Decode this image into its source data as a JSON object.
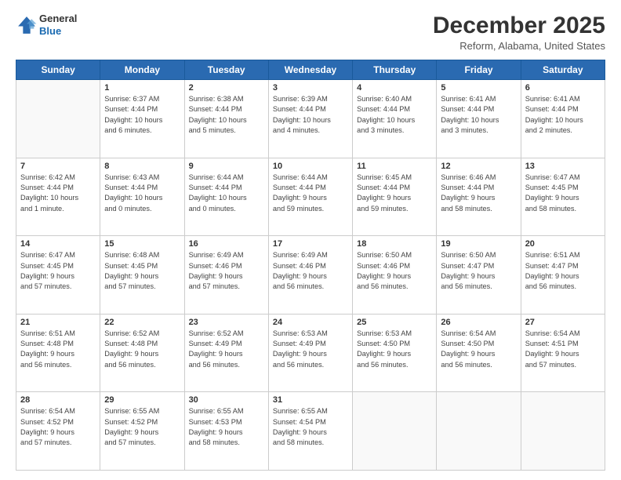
{
  "header": {
    "logo_line1": "General",
    "logo_line2": "Blue",
    "month": "December 2025",
    "location": "Reform, Alabama, United States"
  },
  "days_of_week": [
    "Sunday",
    "Monday",
    "Tuesday",
    "Wednesday",
    "Thursday",
    "Friday",
    "Saturday"
  ],
  "weeks": [
    [
      {
        "day": "",
        "info": ""
      },
      {
        "day": "1",
        "info": "Sunrise: 6:37 AM\nSunset: 4:44 PM\nDaylight: 10 hours\nand 6 minutes."
      },
      {
        "day": "2",
        "info": "Sunrise: 6:38 AM\nSunset: 4:44 PM\nDaylight: 10 hours\nand 5 minutes."
      },
      {
        "day": "3",
        "info": "Sunrise: 6:39 AM\nSunset: 4:44 PM\nDaylight: 10 hours\nand 4 minutes."
      },
      {
        "day": "4",
        "info": "Sunrise: 6:40 AM\nSunset: 4:44 PM\nDaylight: 10 hours\nand 3 minutes."
      },
      {
        "day": "5",
        "info": "Sunrise: 6:41 AM\nSunset: 4:44 PM\nDaylight: 10 hours\nand 3 minutes."
      },
      {
        "day": "6",
        "info": "Sunrise: 6:41 AM\nSunset: 4:44 PM\nDaylight: 10 hours\nand 2 minutes."
      }
    ],
    [
      {
        "day": "7",
        "info": "Sunrise: 6:42 AM\nSunset: 4:44 PM\nDaylight: 10 hours\nand 1 minute."
      },
      {
        "day": "8",
        "info": "Sunrise: 6:43 AM\nSunset: 4:44 PM\nDaylight: 10 hours\nand 0 minutes."
      },
      {
        "day": "9",
        "info": "Sunrise: 6:44 AM\nSunset: 4:44 PM\nDaylight: 10 hours\nand 0 minutes."
      },
      {
        "day": "10",
        "info": "Sunrise: 6:44 AM\nSunset: 4:44 PM\nDaylight: 9 hours\nand 59 minutes."
      },
      {
        "day": "11",
        "info": "Sunrise: 6:45 AM\nSunset: 4:44 PM\nDaylight: 9 hours\nand 59 minutes."
      },
      {
        "day": "12",
        "info": "Sunrise: 6:46 AM\nSunset: 4:44 PM\nDaylight: 9 hours\nand 58 minutes."
      },
      {
        "day": "13",
        "info": "Sunrise: 6:47 AM\nSunset: 4:45 PM\nDaylight: 9 hours\nand 58 minutes."
      }
    ],
    [
      {
        "day": "14",
        "info": "Sunrise: 6:47 AM\nSunset: 4:45 PM\nDaylight: 9 hours\nand 57 minutes."
      },
      {
        "day": "15",
        "info": "Sunrise: 6:48 AM\nSunset: 4:45 PM\nDaylight: 9 hours\nand 57 minutes."
      },
      {
        "day": "16",
        "info": "Sunrise: 6:49 AM\nSunset: 4:46 PM\nDaylight: 9 hours\nand 57 minutes."
      },
      {
        "day": "17",
        "info": "Sunrise: 6:49 AM\nSunset: 4:46 PM\nDaylight: 9 hours\nand 56 minutes."
      },
      {
        "day": "18",
        "info": "Sunrise: 6:50 AM\nSunset: 4:46 PM\nDaylight: 9 hours\nand 56 minutes."
      },
      {
        "day": "19",
        "info": "Sunrise: 6:50 AM\nSunset: 4:47 PM\nDaylight: 9 hours\nand 56 minutes."
      },
      {
        "day": "20",
        "info": "Sunrise: 6:51 AM\nSunset: 4:47 PM\nDaylight: 9 hours\nand 56 minutes."
      }
    ],
    [
      {
        "day": "21",
        "info": "Sunrise: 6:51 AM\nSunset: 4:48 PM\nDaylight: 9 hours\nand 56 minutes."
      },
      {
        "day": "22",
        "info": "Sunrise: 6:52 AM\nSunset: 4:48 PM\nDaylight: 9 hours\nand 56 minutes."
      },
      {
        "day": "23",
        "info": "Sunrise: 6:52 AM\nSunset: 4:49 PM\nDaylight: 9 hours\nand 56 minutes."
      },
      {
        "day": "24",
        "info": "Sunrise: 6:53 AM\nSunset: 4:49 PM\nDaylight: 9 hours\nand 56 minutes."
      },
      {
        "day": "25",
        "info": "Sunrise: 6:53 AM\nSunset: 4:50 PM\nDaylight: 9 hours\nand 56 minutes."
      },
      {
        "day": "26",
        "info": "Sunrise: 6:54 AM\nSunset: 4:50 PM\nDaylight: 9 hours\nand 56 minutes."
      },
      {
        "day": "27",
        "info": "Sunrise: 6:54 AM\nSunset: 4:51 PM\nDaylight: 9 hours\nand 57 minutes."
      }
    ],
    [
      {
        "day": "28",
        "info": "Sunrise: 6:54 AM\nSunset: 4:52 PM\nDaylight: 9 hours\nand 57 minutes."
      },
      {
        "day": "29",
        "info": "Sunrise: 6:55 AM\nSunset: 4:52 PM\nDaylight: 9 hours\nand 57 minutes."
      },
      {
        "day": "30",
        "info": "Sunrise: 6:55 AM\nSunset: 4:53 PM\nDaylight: 9 hours\nand 58 minutes."
      },
      {
        "day": "31",
        "info": "Sunrise: 6:55 AM\nSunset: 4:54 PM\nDaylight: 9 hours\nand 58 minutes."
      },
      {
        "day": "",
        "info": ""
      },
      {
        "day": "",
        "info": ""
      },
      {
        "day": "",
        "info": ""
      }
    ]
  ]
}
